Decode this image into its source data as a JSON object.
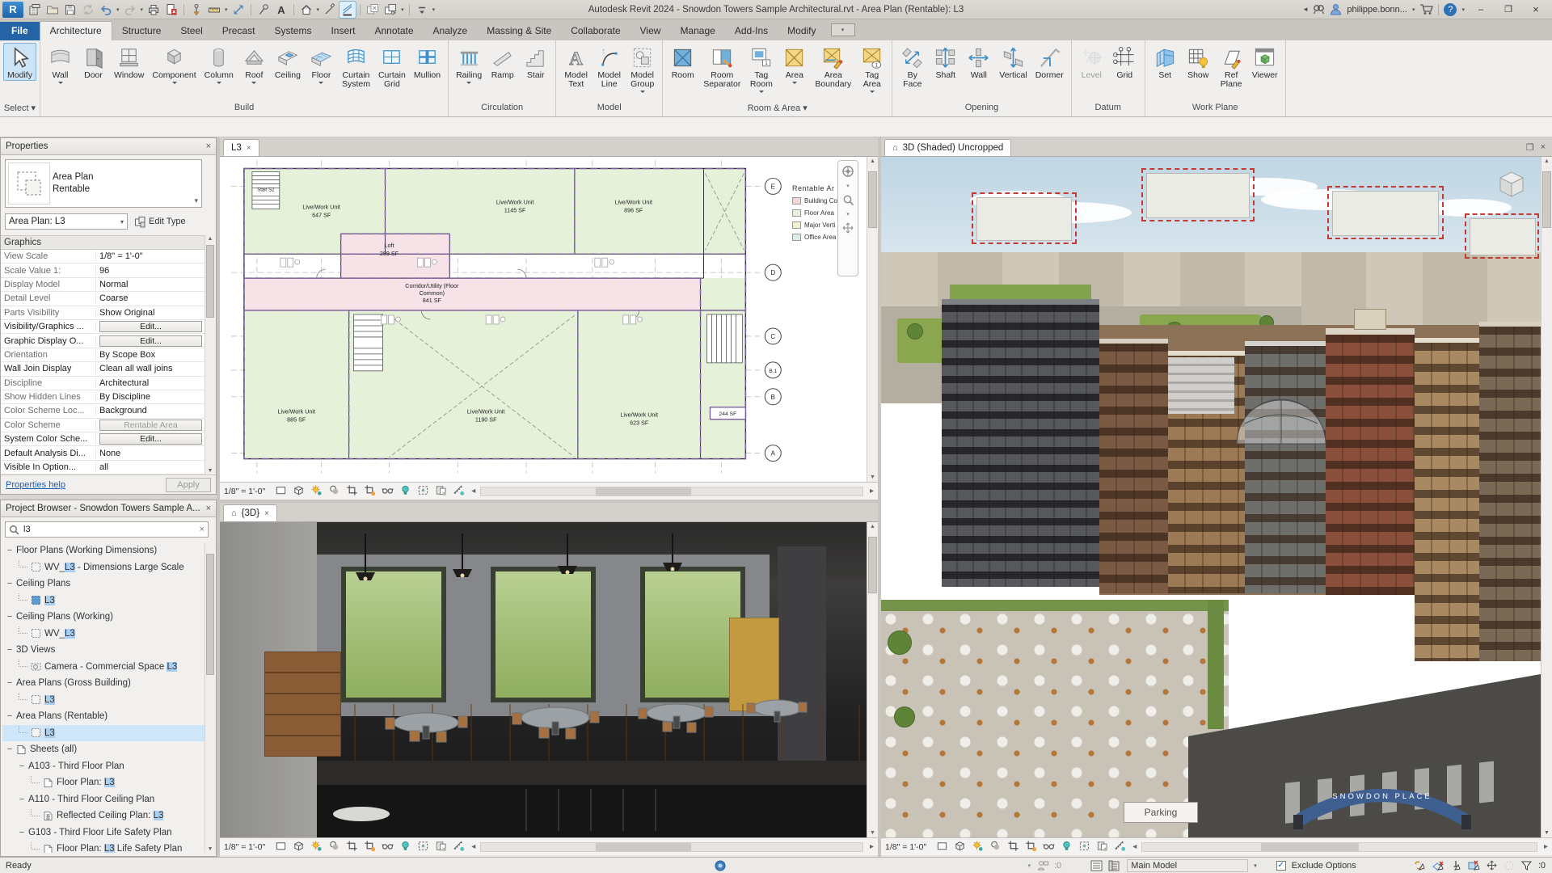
{
  "title_bar": {
    "title": "Autodesk Revit 2024 - Snowdon Towers Sample Architectural.rvt - Area Plan (Rentable): L3",
    "user": "philippe.bonn...",
    "qat": [
      "doc-tabs",
      "open-folder",
      "save",
      "sync-central",
      "undo",
      "caret",
      "redo",
      "caret",
      "print",
      "revision-doc",
      "sep",
      "pin-measure",
      "ruler-dim",
      "caret",
      "aligned-dim",
      "sep",
      "tag",
      "text-a",
      "sep",
      "home-3d",
      "caret",
      "section-mark",
      "thin-lines-active",
      "sep",
      "close-hidden",
      "switch-windows",
      "caret",
      "sep",
      "customize",
      "caret"
    ]
  },
  "ribbon": {
    "tabs": [
      "File",
      "Architecture",
      "Structure",
      "Steel",
      "Precast",
      "Systems",
      "Insert",
      "Annotate",
      "Analyze",
      "Massing & Site",
      "Collaborate",
      "View",
      "Manage",
      "Add-Ins",
      "Modify"
    ],
    "active_tab": "Architecture",
    "panels": [
      {
        "label": "Select",
        "caret": true,
        "buttons": [
          {
            "label": "Modify",
            "icon": "modify",
            "selected": true
          }
        ]
      },
      {
        "label": "Build",
        "buttons": [
          {
            "label": "Wall",
            "icon": "wall",
            "menu": true
          },
          {
            "label": "Door",
            "icon": "door"
          },
          {
            "label": "Window",
            "icon": "window"
          },
          {
            "label": "Component",
            "icon": "component",
            "menu": true
          },
          {
            "label": "Column",
            "icon": "column",
            "menu": true
          },
          {
            "label": "Roof",
            "icon": "roof",
            "menu": true
          },
          {
            "label": "Ceiling",
            "icon": "ceiling"
          },
          {
            "label": "Floor",
            "icon": "floor",
            "menu": true
          },
          {
            "label": "Curtain\nSystem",
            "icon": "curtain-system"
          },
          {
            "label": "Curtain\nGrid",
            "icon": "curtain-grid"
          },
          {
            "label": "Mullion",
            "icon": "mullion"
          }
        ]
      },
      {
        "label": "Circulation",
        "buttons": [
          {
            "label": "Railing",
            "icon": "railing",
            "menu": true
          },
          {
            "label": "Ramp",
            "icon": "ramp"
          },
          {
            "label": "Stair",
            "icon": "stair"
          }
        ]
      },
      {
        "label": "Model",
        "buttons": [
          {
            "label": "Model\nText",
            "icon": "model-text"
          },
          {
            "label": "Model\nLine",
            "icon": "model-line"
          },
          {
            "label": "Model\nGroup",
            "icon": "model-group",
            "menu": true
          }
        ]
      },
      {
        "label": "Room & Area",
        "caret": true,
        "buttons": [
          {
            "label": "Room",
            "icon": "room"
          },
          {
            "label": "Room\nSeparator",
            "icon": "room-separator"
          },
          {
            "label": "Tag\nRoom",
            "icon": "tag-room",
            "menu": true
          },
          {
            "label": "Area",
            "icon": "area",
            "menu": true
          },
          {
            "label": "Area\nBoundary",
            "icon": "area-boundary"
          },
          {
            "label": "Tag\nArea",
            "icon": "tag-area",
            "menu": true
          }
        ]
      },
      {
        "label": "Opening",
        "buttons": [
          {
            "label": "By\nFace",
            "icon": "by-face"
          },
          {
            "label": "Shaft",
            "icon": "shaft"
          },
          {
            "label": "Wall",
            "icon": "wall-opening"
          },
          {
            "label": "Vertical",
            "icon": "vertical-opening"
          },
          {
            "label": "Dormer",
            "icon": "dormer"
          }
        ]
      },
      {
        "label": "Datum",
        "buttons": [
          {
            "label": "Level",
            "icon": "level",
            "disabled": true
          },
          {
            "label": "Grid",
            "icon": "grid"
          }
        ]
      },
      {
        "label": "Work Plane",
        "buttons": [
          {
            "label": "Set",
            "icon": "set"
          },
          {
            "label": "Show",
            "icon": "show"
          },
          {
            "label": "Ref\nPlane",
            "icon": "ref-plane"
          },
          {
            "label": "Viewer",
            "icon": "viewer"
          }
        ]
      }
    ]
  },
  "properties": {
    "header": "Properties",
    "type_name": "Area Plan",
    "type_sub": "Rentable",
    "instance": "Area Plan: L3",
    "edit_type": "Edit Type",
    "section": "Graphics",
    "rows": [
      {
        "label": "View Scale",
        "value": "1/8\" = 1'-0\""
      },
      {
        "label": "Scale Value    1:",
        "value": "96"
      },
      {
        "label": "Display Model",
        "value": "Normal"
      },
      {
        "label": "Detail Level",
        "value": "Coarse"
      },
      {
        "label": "Parts Visibility",
        "value": "Show Original"
      },
      {
        "label": "Visibility/Graphics ...",
        "value": "Edit...",
        "button": true,
        "strong": true
      },
      {
        "label": "Graphic Display O...",
        "value": "Edit...",
        "button": true,
        "strong": true
      },
      {
        "label": "Orientation",
        "value": "By Scope Box"
      },
      {
        "label": "Wall Join Display",
        "value": "Clean all wall joins",
        "strong": true
      },
      {
        "label": "Discipline",
        "value": "Architectural"
      },
      {
        "label": "Show Hidden Lines",
        "value": "By Discipline"
      },
      {
        "label": "Color Scheme Loc...",
        "value": "Background"
      },
      {
        "label": "Color Scheme",
        "value": "Rentable Area",
        "button": true,
        "disabled": true
      },
      {
        "label": "System Color Sche...",
        "value": "Edit...",
        "button": true,
        "strong": true
      },
      {
        "label": "Default Analysis Di...",
        "value": "None",
        "strong": true
      },
      {
        "label": "Visible In Option...",
        "value": "all",
        "strong": true
      }
    ],
    "help": "Properties help",
    "apply": "Apply"
  },
  "project_browser": {
    "header": "Project Browser - Snowdon Towers Sample A...",
    "search": "l3",
    "tree": [
      {
        "kind": "cat",
        "label": "Floor Plans (Working Dimensions)",
        "level": 0
      },
      {
        "kind": "leaf",
        "icon": "plan",
        "label": "WV_L3 - Dimensions Large Scale",
        "hl": "L3",
        "level": 1
      },
      {
        "kind": "cat",
        "label": "Ceiling Plans",
        "level": 0
      },
      {
        "kind": "leaf",
        "icon": "ceiling-active",
        "label": "L3",
        "hl": "L3",
        "level": 1
      },
      {
        "kind": "cat",
        "label": "Ceiling Plans (Working)",
        "level": 0
      },
      {
        "kind": "leaf",
        "icon": "plan",
        "label": "WV_L3",
        "hl": "L3",
        "level": 1
      },
      {
        "kind": "cat",
        "label": "3D Views",
        "level": 0
      },
      {
        "kind": "leaf",
        "icon": "camera",
        "label": "Camera - Commercial Space L3",
        "hl": "L3",
        "level": 1
      },
      {
        "kind": "cat",
        "label": "Area Plans (Gross Building)",
        "level": 0
      },
      {
        "kind": "leaf",
        "icon": "plan",
        "label": "L3",
        "hl": "L3",
        "level": 1
      },
      {
        "kind": "cat",
        "label": "Area Plans (Rentable)",
        "level": 0
      },
      {
        "kind": "leaf",
        "icon": "plan",
        "label": "L3",
        "hl": "L3",
        "level": 1,
        "selected": true
      },
      {
        "kind": "cat",
        "icon": "sheets",
        "label": "Sheets (all)",
        "level": 0
      },
      {
        "kind": "grp",
        "label": "A103 - Third Floor Plan",
        "level": 1
      },
      {
        "kind": "leaf",
        "icon": "sheet",
        "label": "Floor Plan: L3",
        "hl": "L3",
        "level": 2
      },
      {
        "kind": "grp",
        "label": "A110 - Third Floor Ceiling Plan",
        "level": 1
      },
      {
        "kind": "leaf",
        "icon": "rcp",
        "label": "Reflected Ceiling Plan: L3",
        "hl": "L3",
        "level": 2
      },
      {
        "kind": "grp",
        "label": "G103 - Third Floor Life Safety Plan",
        "level": 1
      },
      {
        "kind": "leaf",
        "icon": "sheet",
        "label": "Floor Plan: L3 Life Safety Plan",
        "hl": "L3",
        "level": 2
      }
    ]
  },
  "plan_view": {
    "tab": "L3",
    "scale": "1/8\" = 1'-0\"",
    "stair_label": "Stair S2",
    "grid_bubbles": [
      "E",
      "D",
      "C",
      "B.1",
      "B",
      "A"
    ],
    "rooms": [
      {
        "name": "Live/Work Unit",
        "area": "647 SF"
      },
      {
        "name": "Live/Work Unit",
        "area": "1145 SF"
      },
      {
        "name": "Live/Work Unit",
        "area": "896 SF"
      },
      {
        "name": "Loft",
        "area": "289 SF"
      },
      {
        "name": "Live/Work Unit",
        "area": "885 SF"
      },
      {
        "name": "Live/Work Unit",
        "area": "1190 SF"
      },
      {
        "name": "Live/Work Unit",
        "area": "623 SF"
      },
      {
        "name": "",
        "area": "244 SF"
      }
    ],
    "corridor_lines": [
      "Corridor/Utility (Floor",
      "Common)",
      "841 SF"
    ],
    "legend": {
      "title": "Rentable Ar",
      "items": [
        {
          "label": "Building Co",
          "color": "#f4d7d7"
        },
        {
          "label": "Floor Area",
          "color": "#e7f2da"
        },
        {
          "label": "Major Verti",
          "color": "#f4f0d0"
        },
        {
          "label": "Office Area",
          "color": "#d8efe7"
        }
      ]
    }
  },
  "interior_view": {
    "tab": "{3D}",
    "scale": "1/8\" = 1'-0\""
  },
  "exterior_view": {
    "tab": "3D (Shaded) Uncropped",
    "scale": "1/8\" = 1'-0\"",
    "arch_text": "SNOWDON PLACE",
    "parking_text": "Parking"
  },
  "status_bar": {
    "ready": "Ready",
    "main_model": "Main Model",
    "exclude_options": "Exclude Options",
    "editable_count": ":0",
    "filter_count": ":0"
  }
}
